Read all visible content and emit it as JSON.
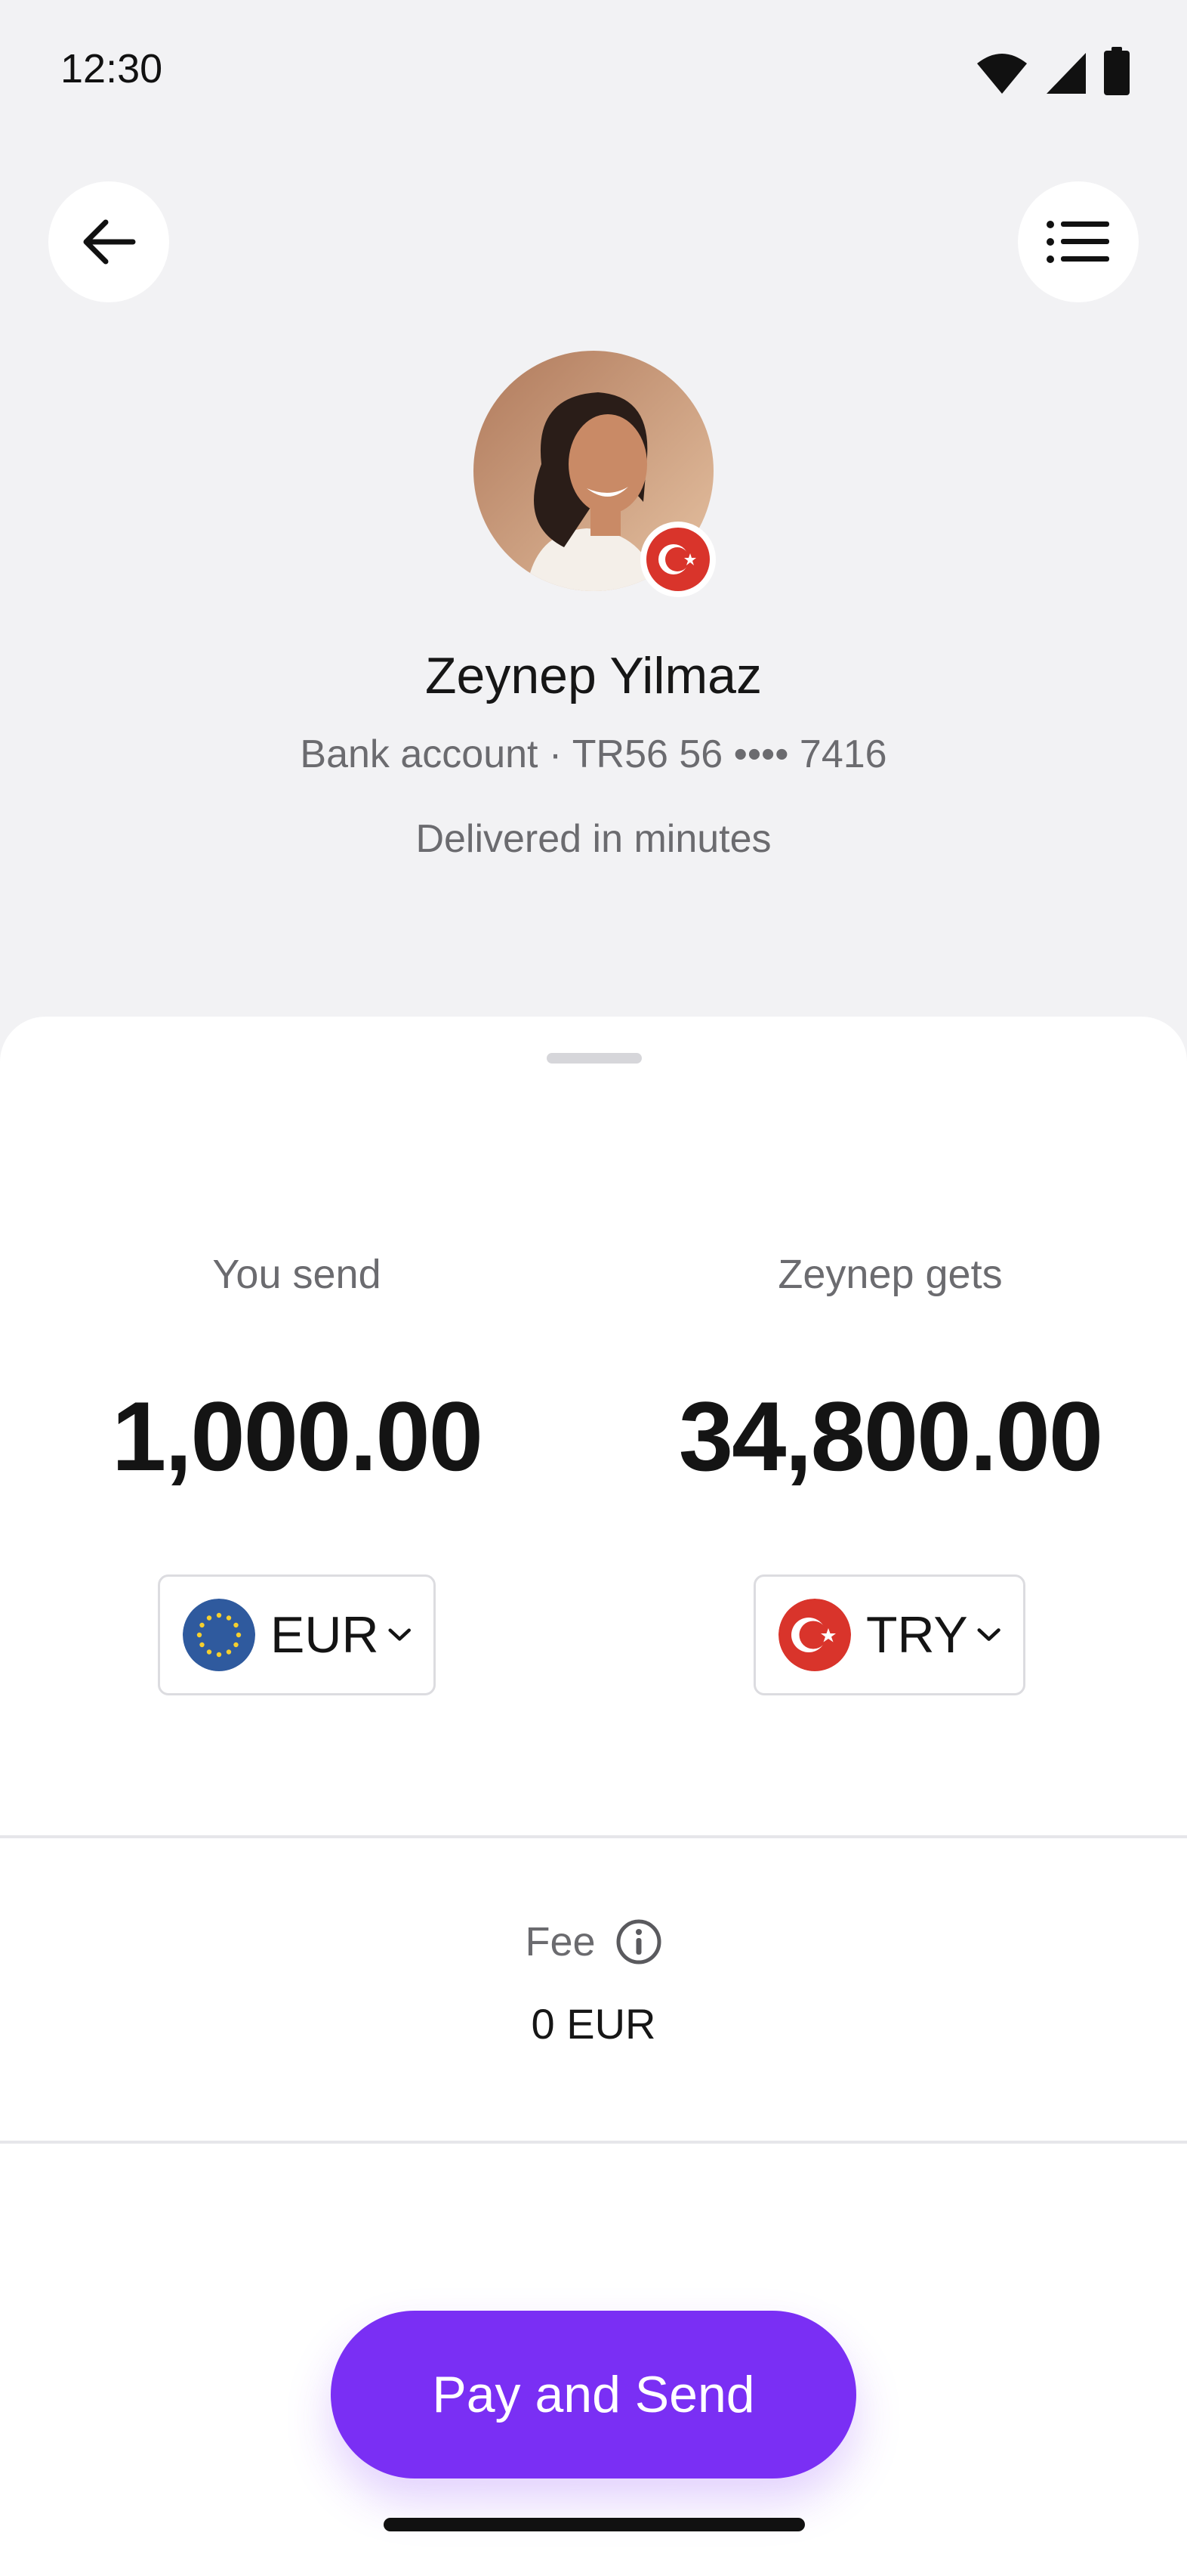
{
  "status_bar": {
    "time": "12:30"
  },
  "header": {
    "back_icon": "arrow-left-icon",
    "menu_icon": "list-icon"
  },
  "recipient": {
    "name": "Zeynep Yilmaz",
    "account": "Bank account · TR56 56 •••• 7416",
    "delivery": "Delivered in minutes",
    "flag": "turkey-flag"
  },
  "transfer": {
    "send_label": "You send",
    "send_amount": "1,000.00",
    "send_currency": "EUR",
    "receive_label": "Zeynep gets",
    "receive_amount": "34,800.00",
    "receive_currency": "TRY"
  },
  "fee": {
    "label": "Fee",
    "value": "0 EUR"
  },
  "actions": {
    "pay_label": "Pay and Send"
  },
  "colors": {
    "accent": "#7a2ff4",
    "background": "#f2f2f4",
    "turkey_red": "#d9342b",
    "eu_blue": "#2f5a9e"
  }
}
